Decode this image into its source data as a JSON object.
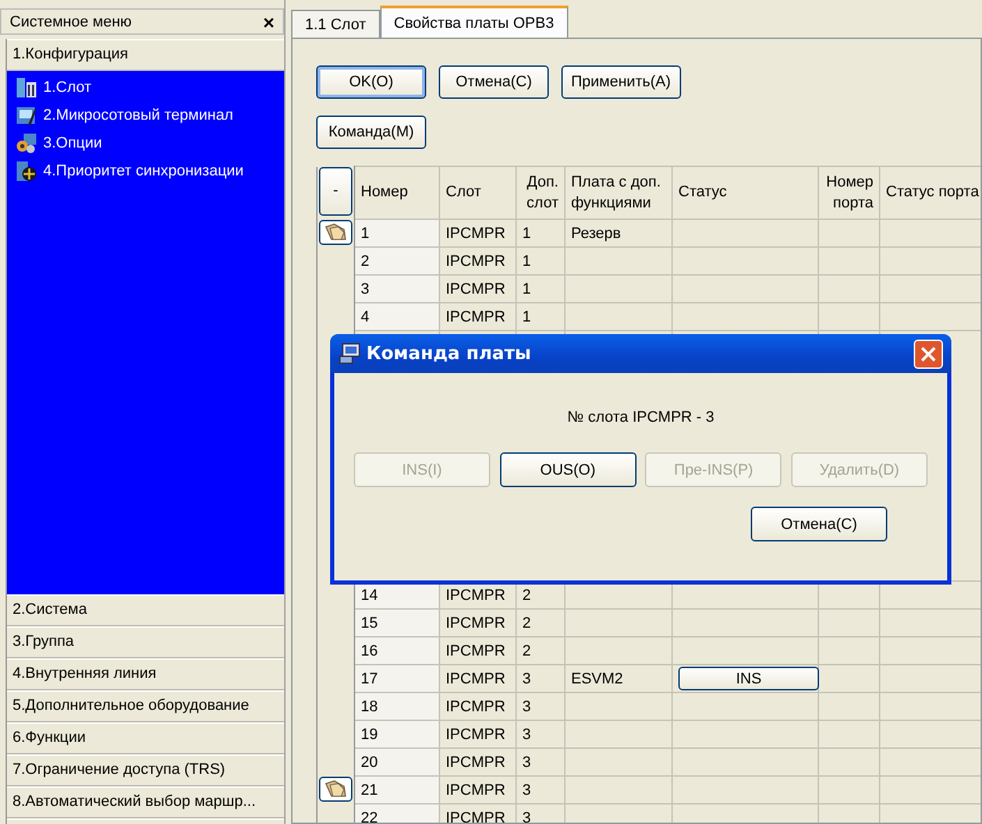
{
  "sidebar": {
    "title": "Системное меню",
    "close": "×",
    "group": {
      "label": "1.Конфигурация",
      "expanded": true,
      "items": [
        {
          "label": "1.Слот",
          "kind": "slot"
        },
        {
          "label": "2.Микросотовый терминал",
          "kind": "terminal"
        },
        {
          "label": "3.Опции",
          "kind": "options"
        },
        {
          "label": "4.Приоритет синхронизации",
          "kind": "sync"
        }
      ]
    },
    "sections": [
      "2.Система",
      "3.Группа",
      "4.Внутренняя линия",
      "5.Дополнительное оборудование",
      "6.Функции",
      "7.Ограничение доступа (TRS)",
      "8.Автоматический выбор маршр..."
    ]
  },
  "tabs": [
    {
      "label": "1.1 Слот",
      "selected": false
    },
    {
      "label": "Свойства платы OPB3",
      "selected": true
    }
  ],
  "buttons": [
    {
      "label": "OK(O)",
      "default": true
    },
    {
      "label": "Отмена(C)",
      "default": false
    },
    {
      "label": "Применить(A)",
      "default": false
    }
  ],
  "command_button": "Команда(M)",
  "table": {
    "corner": "-",
    "columns": [
      "Номер",
      "Слот",
      "Доп. слот",
      "Плата с доп. функциями",
      "Статус",
      "Номер порта",
      "Статус порта"
    ],
    "rows": [
      {
        "number": "1",
        "slot": "IPCMPR",
        "extra_slot": "1",
        "board": "Резерв",
        "expander": true
      },
      {
        "number": "2",
        "slot": "IPCMPR",
        "extra_slot": "1",
        "expander": false
      },
      {
        "number": "3",
        "slot": "IPCMPR",
        "extra_slot": "1",
        "expander": false
      },
      {
        "number": "4",
        "slot": "IPCMPR",
        "extra_slot": "1",
        "expander": false
      },
      {
        "kind": "hidden"
      },
      {
        "number": "14",
        "slot": "IPCMPR",
        "extra_slot": "2",
        "expander": false
      },
      {
        "number": "15",
        "slot": "IPCMPR",
        "extra_slot": "2",
        "expander": false
      },
      {
        "number": "16",
        "slot": "IPCMPR",
        "extra_slot": "2",
        "expander": false
      },
      {
        "number": "17",
        "slot": "IPCMPR",
        "extra_slot": "3",
        "board": "ESVM2",
        "status_button": "INS",
        "expander": false
      },
      {
        "number": "18",
        "slot": "IPCMPR",
        "extra_slot": "3",
        "expander": false
      },
      {
        "number": "19",
        "slot": "IPCMPR",
        "extra_slot": "3",
        "expander": false
      },
      {
        "number": "20",
        "slot": "IPCMPR",
        "extra_slot": "3",
        "expander": false
      },
      {
        "number": "21",
        "slot": "IPCMPR",
        "extra_slot": "3",
        "expander": true
      },
      {
        "number": "22",
        "slot": "IPCMPR",
        "extra_slot": "3",
        "expander": false
      }
    ]
  },
  "dialog": {
    "title": "Команда платы",
    "message": "№ слота IPCMPR - 3",
    "buttons": [
      {
        "label": "INS(I)",
        "disabled": true
      },
      {
        "label": "OUS(O)",
        "disabled": false
      },
      {
        "label": "Пре-INS(P)",
        "disabled": true
      },
      {
        "label": "Удалить(D)",
        "disabled": true
      }
    ],
    "cancel": "Отмена(C)"
  }
}
